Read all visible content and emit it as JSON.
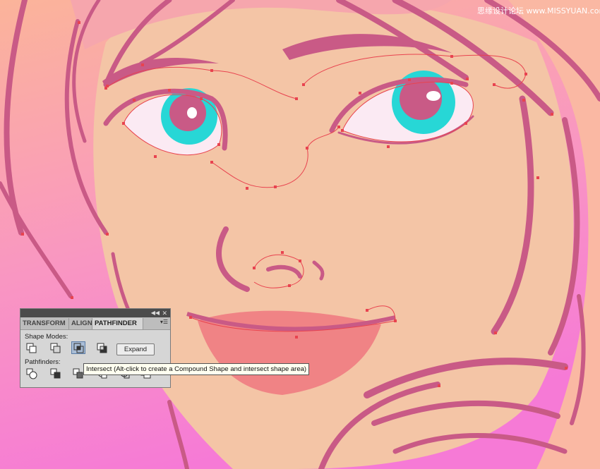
{
  "watermark": "思缘设计论坛 www.MISSYUAN.com",
  "panel": {
    "tabs": [
      "TRANSFORM",
      "ALIGN",
      "PATHFINDER"
    ],
    "active_tab": "PATHFINDER",
    "shape_modes_label": "Shape Modes:",
    "pathfinders_label": "Pathfinders:",
    "expand_label": "Expand",
    "tooltip": "Intersect (Alt-click to create a Compound Shape and intersect shape area)"
  },
  "colors": {
    "skin": "#f4c5a6",
    "hair": "#f67ec8",
    "outline": "#c95a86",
    "anchor": "#e8434f",
    "iris": "#27d7d6",
    "lip": "#ef7b82",
    "panel_bg": "#d6d6d6",
    "intersect_pressed": "#a9bdd6"
  },
  "icons": {
    "shape_modes": [
      "unite-icon",
      "minus-front-icon",
      "intersect-icon",
      "exclude-icon"
    ],
    "pathfinders": [
      "divide-icon",
      "trim-icon",
      "merge-icon",
      "crop-icon",
      "outline-icon",
      "minus-back-icon"
    ]
  }
}
